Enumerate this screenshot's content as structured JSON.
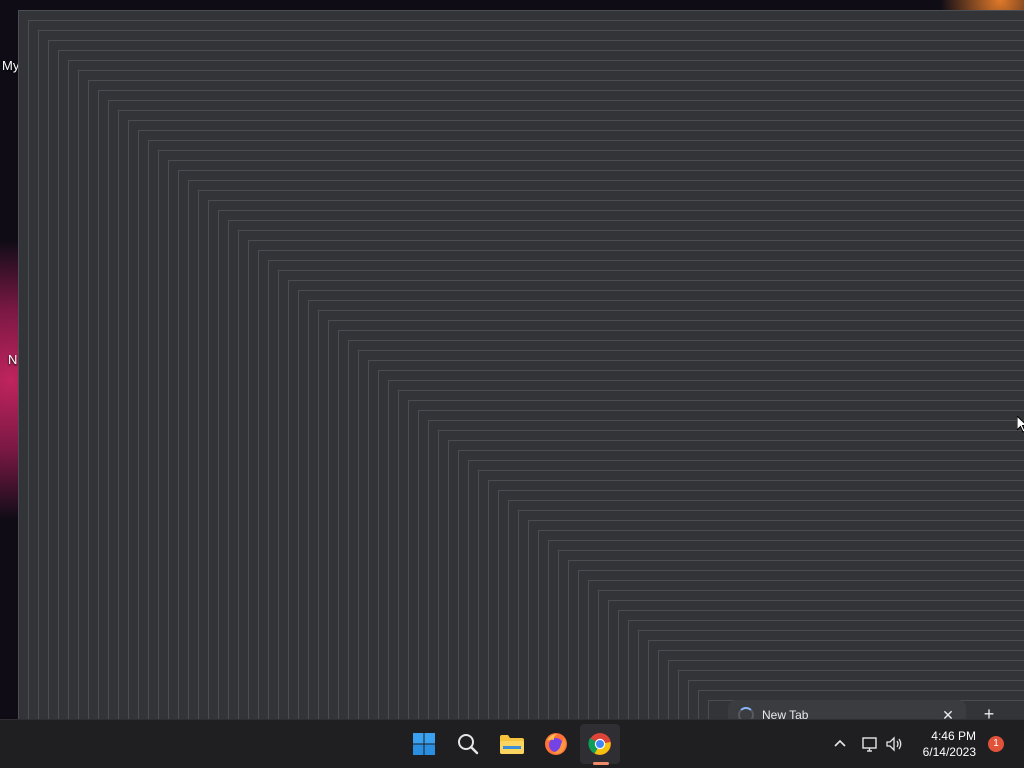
{
  "desktop": {
    "icon_labels": [
      "My",
      "N"
    ]
  },
  "browser_ghost": {
    "tab_title": "New Tab",
    "close_glyph": "✕",
    "new_tab_glyph": "+"
  },
  "taskbar": {
    "apps": [
      {
        "name": "Start",
        "icon": "windows-start-icon"
      },
      {
        "name": "Search",
        "icon": "search-icon"
      },
      {
        "name": "File Explorer",
        "icon": "folder-icon"
      },
      {
        "name": "Firefox",
        "icon": "firefox-icon"
      },
      {
        "name": "Google Chrome",
        "icon": "chrome-icon",
        "active": true
      }
    ],
    "tray": {
      "time": "4:46 PM",
      "date": "6/14/2023",
      "notification_count": "1"
    }
  },
  "colors": {
    "window_fill": "#323438",
    "window_edge": "#4a4d52",
    "taskbar": "#1f1f22",
    "accent_indicator": "#f28b6a"
  }
}
